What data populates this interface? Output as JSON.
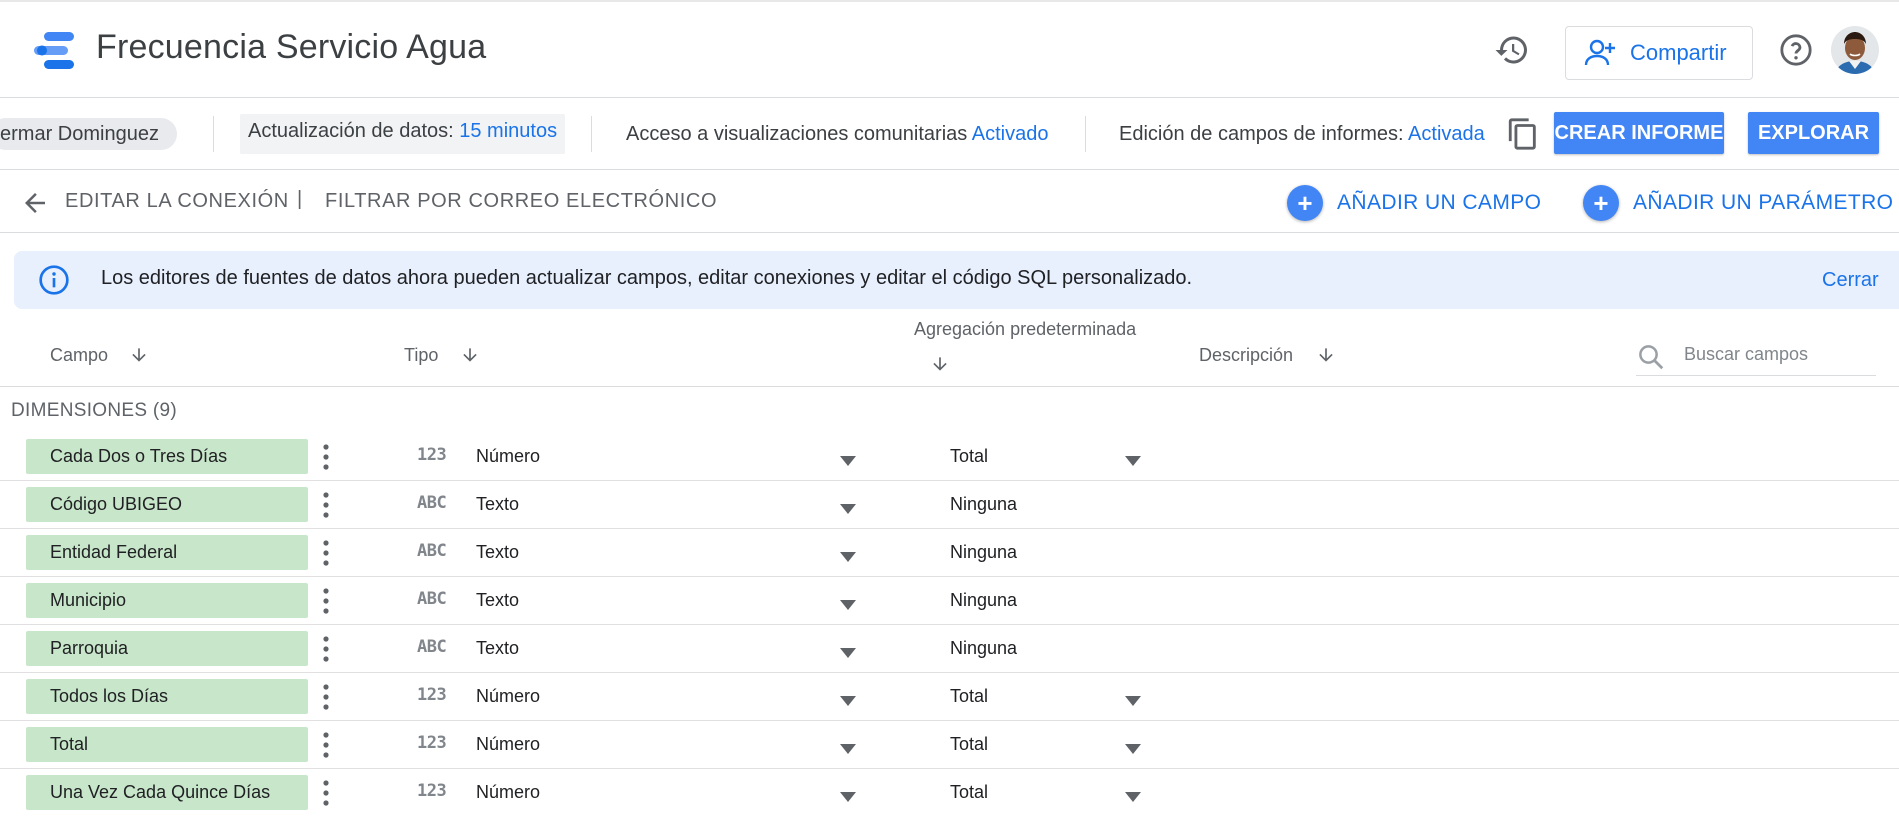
{
  "header": {
    "title": "Frecuencia Servicio Agua",
    "share_label": "Compartir"
  },
  "infobar": {
    "owner": "ermar Dominguez",
    "refresh_label": "Actualización de datos:",
    "refresh_value": "15 minutos",
    "community_label": "Acceso a visualizaciones comunitarias",
    "community_value": "Activado",
    "edit_fields_label": "Edición de campos de informes:",
    "edit_fields_value": "Activada",
    "create_report": "CREAR INFORME",
    "explore": "EXPLORAR"
  },
  "toolbar": {
    "edit_connection": "EDITAR LA CONEXIÓN",
    "separator": "|",
    "filter_email": "FILTRAR POR CORREO ELECTRÓNICO",
    "add_field": "AÑADIR UN CAMPO",
    "add_parameter": "AÑADIR UN PARÁMETRO"
  },
  "banner": {
    "text": "Los editores de fuentes de datos ahora pueden actualizar campos, editar conexiones y editar el código SQL personalizado.",
    "close": "Cerrar"
  },
  "columns": {
    "field": "Campo",
    "type": "Tipo",
    "aggregation": "Agregación predeterminada",
    "description": "Descripción",
    "search_placeholder": "Buscar campos"
  },
  "dimensions_label": "DIMENSIONES (9)",
  "rows": [
    {
      "name": "Cada Dos o Tres Días",
      "type_icon": "123",
      "type": "Número",
      "aggregation": "Total",
      "agg_dropdown": true
    },
    {
      "name": "Código UBIGEO",
      "type_icon": "ABC",
      "type": "Texto",
      "aggregation": "Ninguna",
      "agg_dropdown": false
    },
    {
      "name": "Entidad Federal",
      "type_icon": "ABC",
      "type": "Texto",
      "aggregation": "Ninguna",
      "agg_dropdown": false
    },
    {
      "name": "Municipio",
      "type_icon": "ABC",
      "type": "Texto",
      "aggregation": "Ninguna",
      "agg_dropdown": false
    },
    {
      "name": "Parroquia",
      "type_icon": "ABC",
      "type": "Texto",
      "aggregation": "Ninguna",
      "agg_dropdown": false
    },
    {
      "name": "Todos los Días",
      "type_icon": "123",
      "type": "Número",
      "aggregation": "Total",
      "agg_dropdown": true
    },
    {
      "name": "Total",
      "type_icon": "123",
      "type": "Número",
      "aggregation": "Total",
      "agg_dropdown": true
    },
    {
      "name": "Una Vez Cada Quince Días",
      "type_icon": "123",
      "type": "Número",
      "aggregation": "Total",
      "agg_dropdown": true
    }
  ],
  "colors": {
    "accent": "#1a73e8",
    "button_blue": "#4285f4",
    "chip_green": "#c8e6c9",
    "banner_bg": "#e8f0fe"
  }
}
